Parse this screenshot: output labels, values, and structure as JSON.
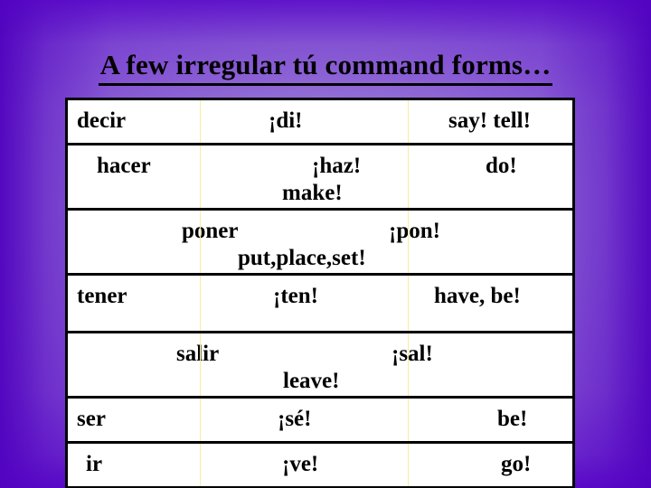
{
  "slide": {
    "title": "A few irregular tú command forms…",
    "background_color_outer": "#5502be",
    "background_color_inner": "#9d7ad8",
    "text_color": "#000000",
    "table_background": "#ffffff",
    "table_border_color": "#000000",
    "column_rule_color": "#f2efa0"
  },
  "table": {
    "columns": [
      "infinitive",
      "command",
      "english"
    ],
    "rows": [
      {
        "infinitive": "decir",
        "command": "¡di!",
        "english": "say! tell!",
        "english_second_line": ""
      },
      {
        "infinitive": "hacer",
        "command": "¡haz!",
        "english": "do!",
        "english_second_line": "make!"
      },
      {
        "infinitive": "poner",
        "command": "¡pon!",
        "english": "",
        "english_second_line": "put,place,set!"
      },
      {
        "infinitive": "tener",
        "command": "¡ten!",
        "english": "have, be!",
        "english_second_line": ""
      },
      {
        "infinitive": "salir",
        "command": "¡sal!",
        "english": "",
        "english_second_line": "leave!"
      },
      {
        "infinitive": "ser",
        "command": "¡sé!",
        "english": "be!",
        "english_second_line": ""
      },
      {
        "infinitive": "ir",
        "command": "¡ve!",
        "english": "go!",
        "english_second_line": ""
      }
    ]
  }
}
